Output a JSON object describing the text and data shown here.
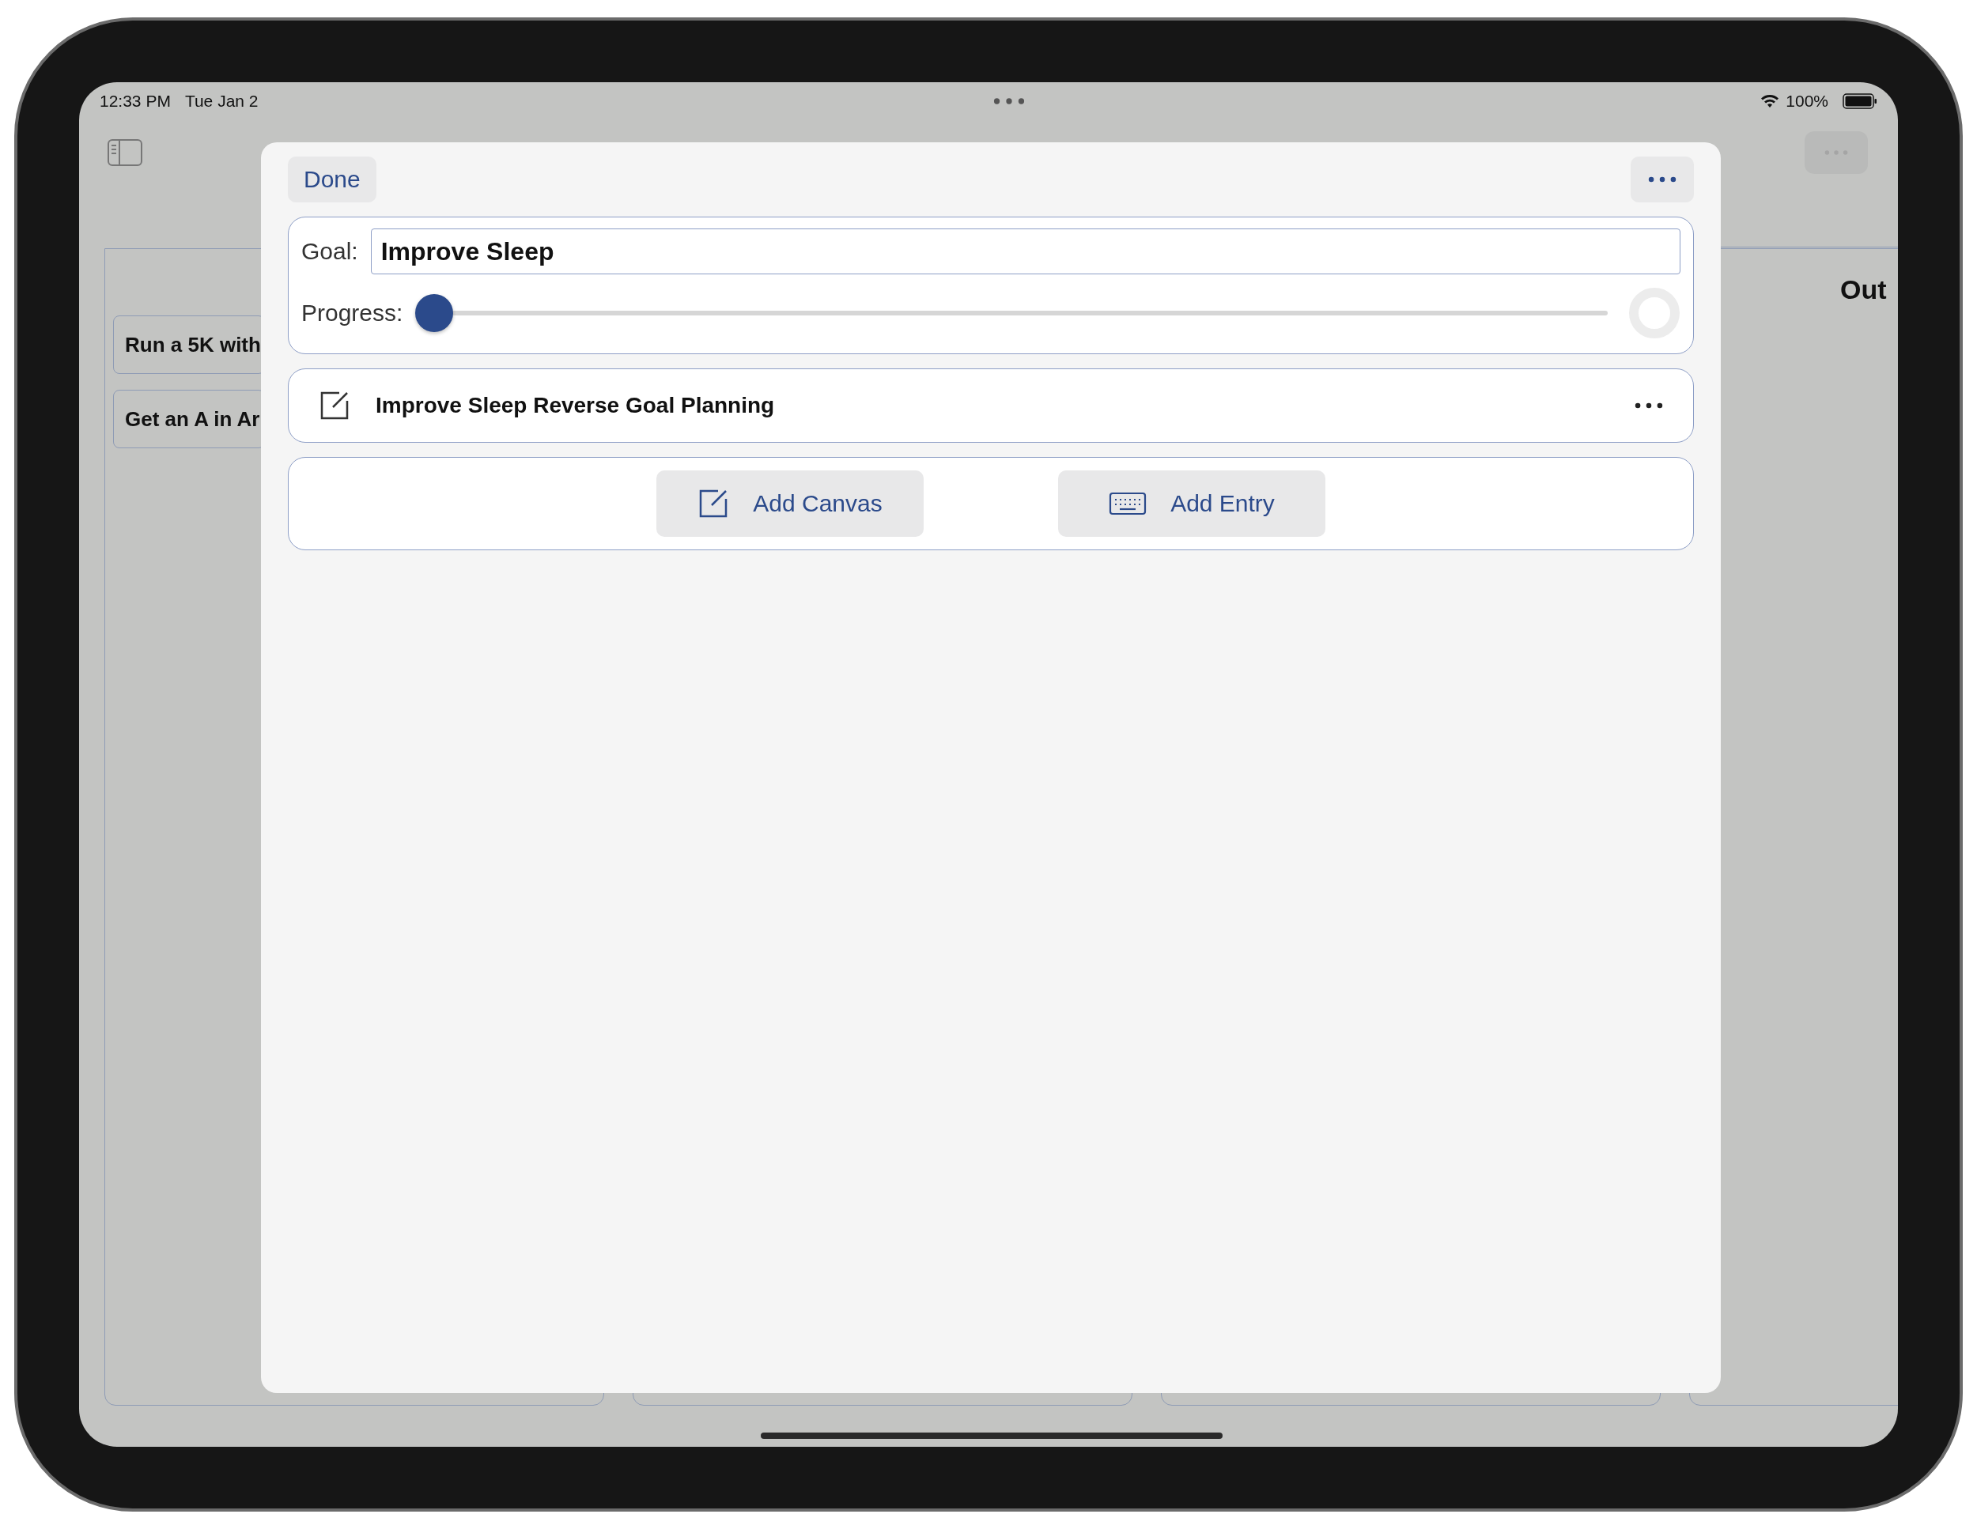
{
  "status_bar": {
    "time": "12:33 PM",
    "date": "Tue Jan 2",
    "battery": "100%"
  },
  "board": {
    "column_1_cards": [
      "Run a 5K with",
      "Get an A in Ar"
    ],
    "column_4_header": "Out"
  },
  "sheet": {
    "done": "Done",
    "goal_label": "Goal:",
    "goal_value": "Improve Sleep",
    "progress_label": "Progress:",
    "progress": {
      "level": 0
    },
    "entries": [
      {
        "title": "Improve Sleep Reverse Goal Planning"
      }
    ],
    "actions": [
      {
        "kind": "canvas",
        "label": "Add Canvas"
      },
      {
        "kind": "entry",
        "label": "Add Entry"
      }
    ]
  }
}
